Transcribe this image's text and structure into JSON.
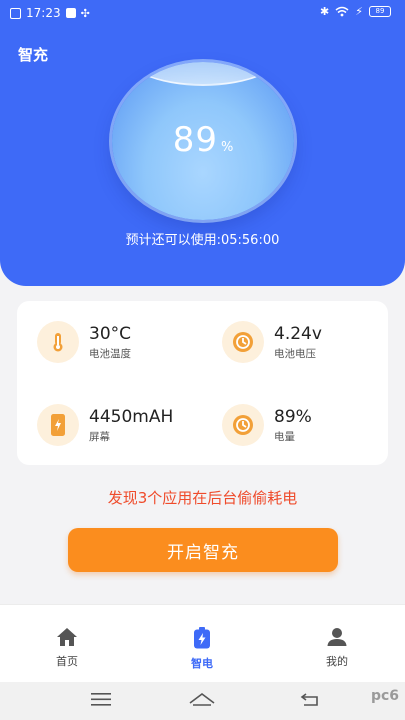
{
  "status_bar": {
    "time": "17:23",
    "battery": "89"
  },
  "app": {
    "title": "智充"
  },
  "battery": {
    "percent": "89",
    "percent_unit": "%",
    "estimate_text": "预计还可以使用:05:56:00"
  },
  "stats": [
    {
      "value": "30°C",
      "label": "电池温度",
      "icon": "thermometer-icon"
    },
    {
      "value": "4.24v",
      "label": "电池电压",
      "icon": "voltage-icon"
    },
    {
      "value": "4450mAH",
      "label": "屏幕",
      "icon": "phone-charging-icon"
    },
    {
      "value": "89%",
      "label": "电量",
      "icon": "battery-level-icon"
    }
  ],
  "warning": "发现3个应用在后台偷偷耗电",
  "cta_label": "开启智充",
  "tabs": [
    {
      "label": "首页",
      "icon": "home-icon"
    },
    {
      "label": "智电",
      "icon": "battery-bolt-icon",
      "active": true
    },
    {
      "label": "我的",
      "icon": "profile-icon"
    }
  ],
  "watermark": "pc6",
  "colors": {
    "primary": "#3e6af7",
    "accent": "#fb8d1e",
    "warning": "#ef4b2b",
    "icon_bg": "#fdf0dc",
    "icon_fg": "#f2a038"
  }
}
